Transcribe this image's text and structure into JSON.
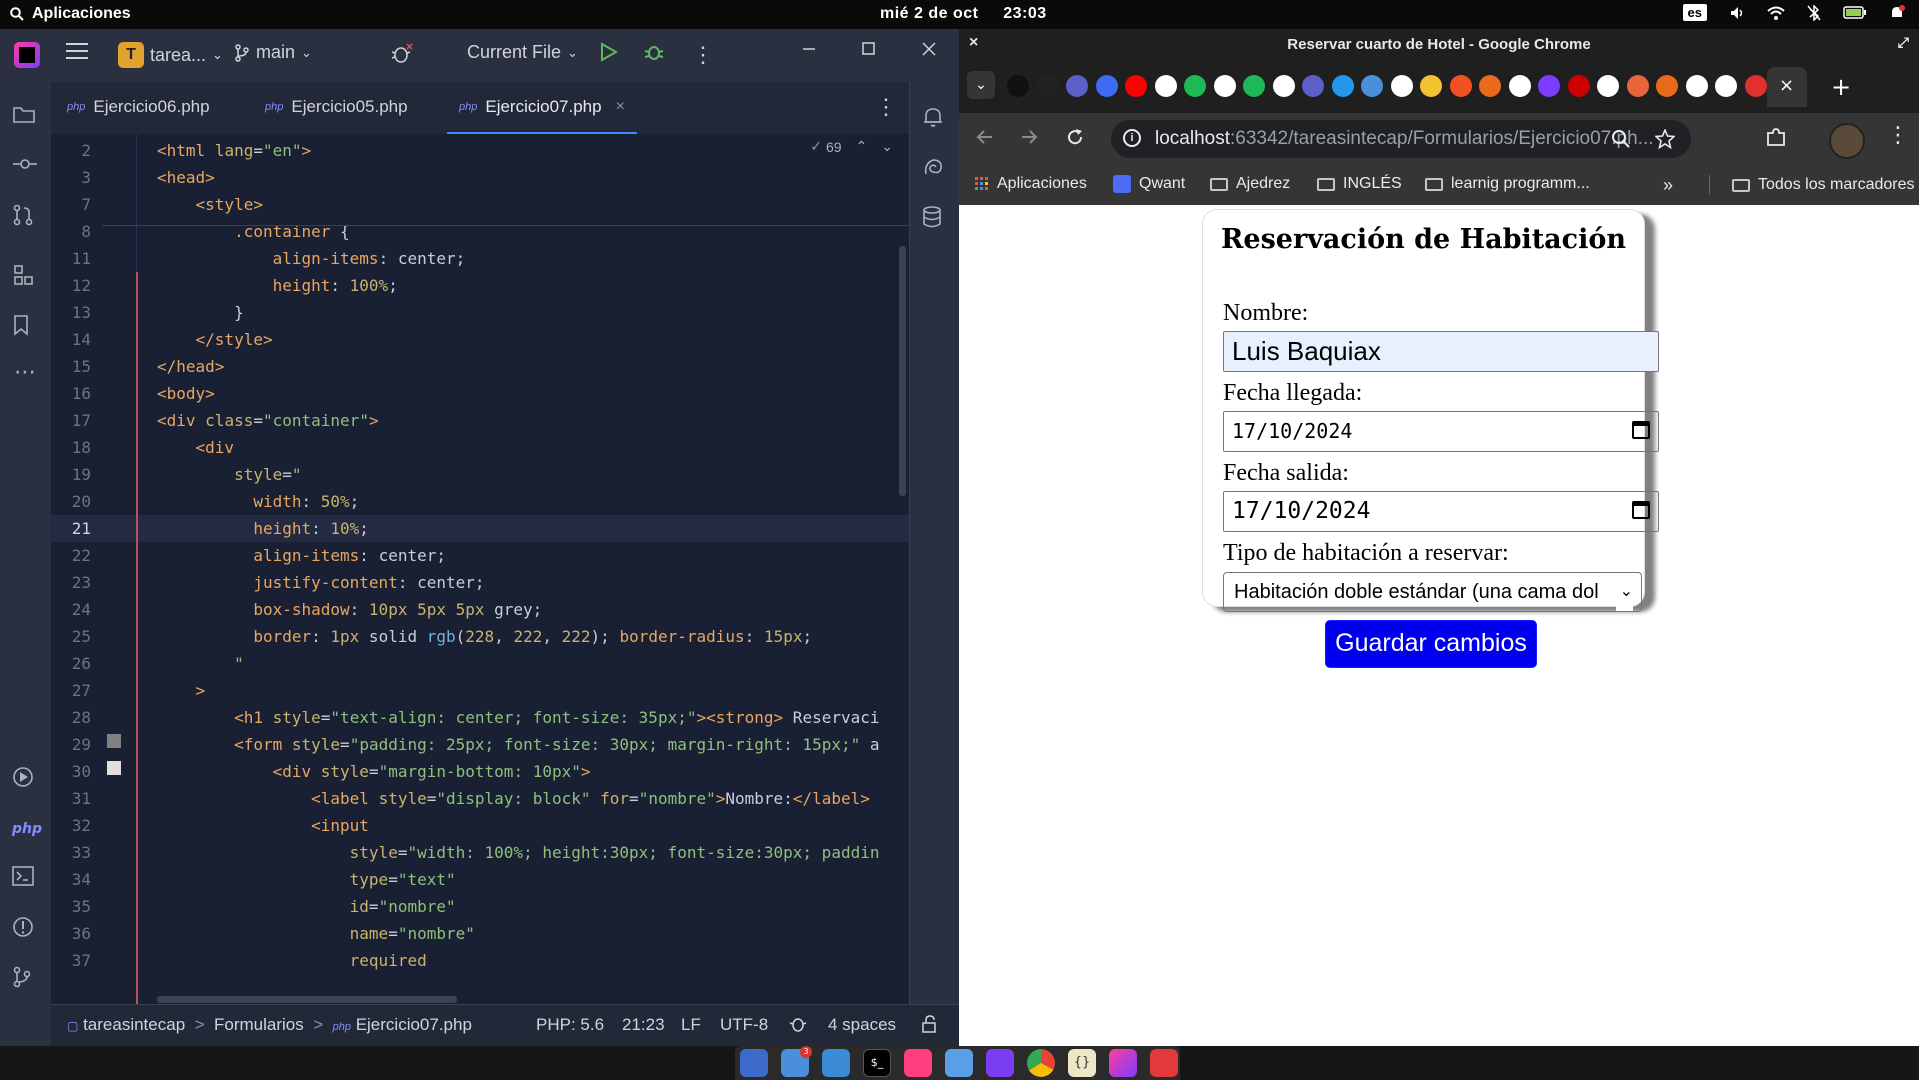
{
  "system_bar": {
    "apps_label": "Aplicaciones",
    "date": "mié 2 de oct",
    "time": "23:03",
    "keyboard_layout": "es"
  },
  "ide": {
    "project_badge": "T",
    "project_name": "tarea...",
    "branch": "main",
    "run_config": "Current File",
    "tabs": [
      {
        "label": "Ejercicio06.php",
        "icon": "php"
      },
      {
        "label": "Ejercicio05.php",
        "icon": "php"
      },
      {
        "label": "Ejercicio07.php",
        "icon": "php"
      }
    ],
    "inspection_count": "69",
    "lines": [
      {
        "n": "2",
        "html": "<span class=\"t-tag\">&lt;html</span> <span class=\"t-attr\">lang</span>=<span class=\"t-str\">\"en\"</span><span class=\"t-tag\">&gt;</span>"
      },
      {
        "n": "3",
        "html": "<span class=\"t-tag\">&lt;head&gt;</span>"
      },
      {
        "n": "7",
        "html": "    <span class=\"t-tag\">&lt;style&gt;</span>"
      },
      {
        "n": "8",
        "html": "        <span class=\"t-sel\">.container</span> {"
      },
      {
        "n": "11",
        "html": "            <span class=\"t-prop\">align-items</span>: center;"
      },
      {
        "n": "12",
        "html": "            <span class=\"t-prop\">height</span>: <span class=\"t-num\">100%</span>;"
      },
      {
        "n": "13",
        "html": "        }"
      },
      {
        "n": "14",
        "html": "    <span class=\"t-tag\">&lt;/style&gt;</span>"
      },
      {
        "n": "15",
        "html": "<span class=\"t-tag\">&lt;/head&gt;</span>"
      },
      {
        "n": "16",
        "html": "<span class=\"t-tag\">&lt;body&gt;</span>"
      },
      {
        "n": "17",
        "html": "<span class=\"t-tag\">&lt;div</span> <span class=\"t-attr\">class</span>=<span class=\"t-str\">\"container\"</span><span class=\"t-tag\">&gt;</span>"
      },
      {
        "n": "18",
        "html": "    <span class=\"t-tag\">&lt;div</span>"
      },
      {
        "n": "19",
        "html": "        <span class=\"t-attr\">style</span>=<span class=\"t-str\">\"</span>"
      },
      {
        "n": "20",
        "html": "          <span class=\"t-prop\">width</span>: <span class=\"t-num\">50%</span>;"
      },
      {
        "n": "21",
        "html": "          <span class=\"t-prop\">height</span>: <span class=\"t-num\">10%</span>;"
      },
      {
        "n": "22",
        "html": "          <span class=\"t-prop\">align-items</span>: center;"
      },
      {
        "n": "23",
        "html": "          <span class=\"t-prop\">justify-content</span>: center;"
      },
      {
        "n": "24",
        "html": "          <span class=\"t-prop\">box-shadow</span>: <span class=\"t-num\">10px 5px 5px</span> grey;"
      },
      {
        "n": "25",
        "html": "          <span class=\"t-prop\">border</span>: <span class=\"t-num\">1px</span> solid <span class=\"t-fn\">rgb</span>(<span class=\"t-num\">228</span>, <span class=\"t-num\">222</span>, <span class=\"t-num\">222</span>); <span class=\"t-prop\">border-radius</span>: <span class=\"t-num\">15px</span>;"
      },
      {
        "n": "26",
        "html": "        <span class=\"t-str\">\"</span>"
      },
      {
        "n": "27",
        "html": "    <span class=\"t-tag\">&gt;</span>"
      },
      {
        "n": "28",
        "html": "        <span class=\"t-tag\">&lt;h1</span> <span class=\"t-attr\">style</span>=<span class=\"t-str\">\"text-align: center; font-size: 35px;\"</span><span class=\"t-tag\">&gt;&lt;strong&gt;</span> Reservaci"
      },
      {
        "n": "29",
        "html": "        <span class=\"t-tag\">&lt;form</span> <span class=\"t-attr\">style</span>=<span class=\"t-str\">\"padding: 25px; font-size: 30px; margin-right: 15px;\"</span> a"
      },
      {
        "n": "30",
        "html": "            <span class=\"t-tag\">&lt;div</span> <span class=\"t-attr\">style</span>=<span class=\"t-str\">\"margin-bottom: 10px\"</span><span class=\"t-tag\">&gt;</span>"
      },
      {
        "n": "31",
        "html": "                <span class=\"t-tag\">&lt;label</span> <span class=\"t-attr\">style</span>=<span class=\"t-str\">\"display: block\"</span> <span class=\"t-attr\">for</span>=<span class=\"t-str\">\"nombre\"</span><span class=\"t-tag\">&gt;</span>Nombre:<span class=\"t-tag\">&lt;/label&gt;</span>"
      },
      {
        "n": "32",
        "html": "                <span class=\"t-tag\">&lt;input</span>"
      },
      {
        "n": "33",
        "html": "                    <span class=\"t-attr\">style</span>=<span class=\"t-str\">\"width: 100%; height:30px; font-size:30px; paddin</span>"
      },
      {
        "n": "34",
        "html": "                    <span class=\"t-attr\">type</span>=<span class=\"t-str\">\"text\"</span>"
      },
      {
        "n": "35",
        "html": "                    <span class=\"t-attr\">id</span>=<span class=\"t-str\">\"nombre\"</span>"
      },
      {
        "n": "36",
        "html": "                    <span class=\"t-attr\">name</span>=<span class=\"t-str\">\"nombre\"</span>"
      },
      {
        "n": "37",
        "html": "                    <span class=\"t-attr\">required</span>"
      }
    ],
    "current_line": "21",
    "breadcrumb": [
      "tareasintecap",
      "Formularios",
      "Ejercicio07.php"
    ],
    "status": {
      "php_version": "PHP: 5.6",
      "position": "21:23",
      "line_ending": "LF",
      "encoding": "UTF-8",
      "indent": "4 spaces"
    }
  },
  "chrome": {
    "window_title": "Reservar cuarto de Hotel - Google Chrome",
    "url_host": "localhost",
    "url_rest": ":63342/tareasintecap/Formularios/Ejercicio07.ph...",
    "bookmarks": [
      "Aplicaciones",
      "Qwant",
      "Ajedrez",
      "INGLÉS",
      "learnig programm..."
    ],
    "all_bookmarks": "Todos los marcadores",
    "form": {
      "heading": "Reservación de Habitación",
      "nombre_label": "Nombre:",
      "nombre_value": "Luis Baquiax",
      "llegada_label": "Fecha llegada:",
      "llegada_value": "17/10/2024",
      "salida_label": "Fecha salida:",
      "salida_value": "17/10/2024",
      "tipo_label": "Tipo de habitación a reservar:",
      "tipo_value": "Habitación doble estándar (una cama dol",
      "submit_label": "Guardar cambios"
    }
  }
}
